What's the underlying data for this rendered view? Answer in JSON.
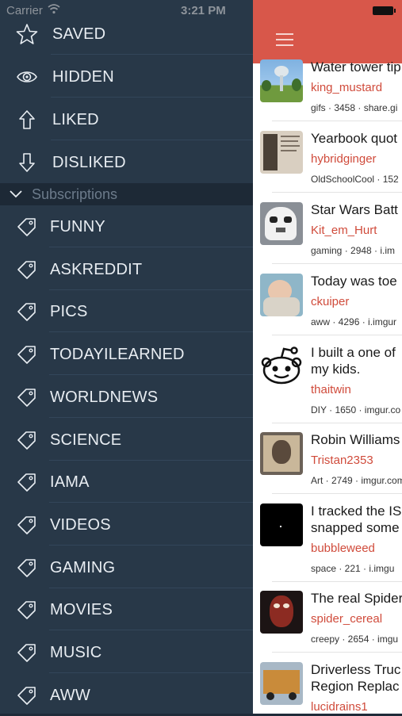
{
  "status_bar": {
    "carrier": "Carrier",
    "time": "3:21 PM"
  },
  "menu": {
    "items": [
      {
        "label": "SAVED",
        "icon": "star-icon"
      },
      {
        "label": "HIDDEN",
        "icon": "eye-icon"
      },
      {
        "label": "LIKED",
        "icon": "arrow-up-icon"
      },
      {
        "label": "DISLIKED",
        "icon": "arrow-down-icon"
      }
    ],
    "subscriptions_header": "Subscriptions",
    "subscriptions": [
      {
        "label": "FUNNY"
      },
      {
        "label": "ASKREDDIT"
      },
      {
        "label": "PICS"
      },
      {
        "label": "TODAYILEARNED"
      },
      {
        "label": "WORLDNEWS"
      },
      {
        "label": "SCIENCE"
      },
      {
        "label": "IAMA"
      },
      {
        "label": "VIDEOS"
      },
      {
        "label": "GAMING"
      },
      {
        "label": "MOVIES"
      },
      {
        "label": "MUSIC"
      },
      {
        "label": "AWW"
      }
    ]
  },
  "feed": {
    "accent_color": "#d8574a",
    "posts": [
      {
        "title": "Water tower tip",
        "title2": "",
        "author": "king_mustard",
        "meta": "gifs · 3458 · share.gi",
        "thumb": "water-tower"
      },
      {
        "title": "Yearbook quot",
        "title2": "",
        "author": "hybridginger",
        "meta": "OldSchoolCool · 152",
        "thumb": "yearbook"
      },
      {
        "title": "Star Wars Batt",
        "title2": "",
        "author": "Kit_em_Hurt",
        "meta": "gaming · 2948 · i.im",
        "thumb": "stormtrooper"
      },
      {
        "title": "Today was toe",
        "title2": "",
        "author": "ckuiper",
        "meta": "aww · 4296 · i.imgur",
        "thumb": "baby"
      },
      {
        "title": "I built a one of",
        "title2": "my kids.",
        "author": "thaitwin",
        "meta": "DIY · 1650 · imgur.co",
        "thumb": "reddit-alien"
      },
      {
        "title": "Robin Williams",
        "title2": "",
        "author": "Tristan2353",
        "meta": "Art · 2749 · imgur.com",
        "thumb": "portrait"
      },
      {
        "title": "I tracked the IS",
        "title2": "snapped some",
        "author": "bubbleweed",
        "meta": "space · 221 · i.imgu",
        "thumb": "space"
      },
      {
        "title": "The real Spider",
        "title2": "",
        "author": "spider_cereal",
        "meta": "creepy · 2654 · imgu",
        "thumb": "spider"
      },
      {
        "title": "Driverless Truc",
        "title2": "Region Replac",
        "author": "lucidrains1",
        "meta": "",
        "thumb": "truck"
      }
    ]
  }
}
